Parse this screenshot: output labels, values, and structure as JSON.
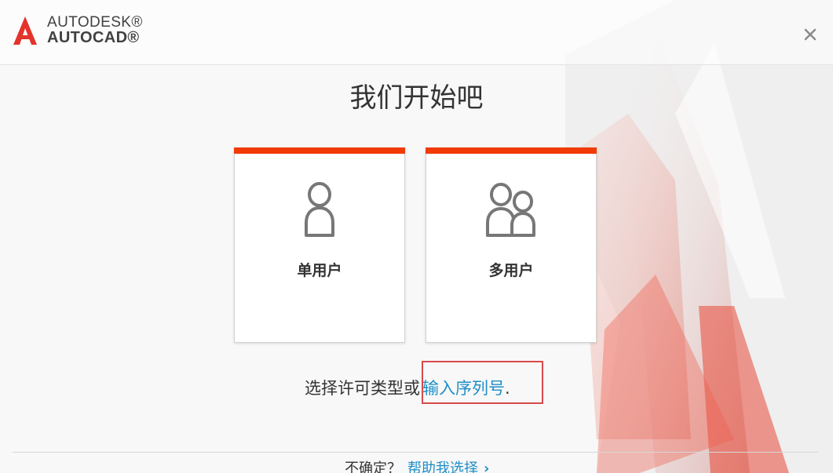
{
  "brand": {
    "line1": "AUTODESK®",
    "line2": "AUTOCAD®",
    "accent": "#f13a06",
    "logo_icon": "autodesk-a-icon"
  },
  "window": {
    "close_icon": "close-icon",
    "title": "我们开始吧"
  },
  "cards": [
    {
      "label": "单用户",
      "icon": "single-user-icon"
    },
    {
      "label": "多用户",
      "icon": "multi-user-icon"
    }
  ],
  "license_prompt": {
    "text": "选择许可类型或",
    "link": "输入序列号",
    "suffix": "."
  },
  "footer": {
    "question": "不确定？",
    "help_link": "帮助我选择",
    "chevron_icon": "chevron-right-icon"
  },
  "colors": {
    "link": "#1f8ec8",
    "highlight_box": "#d84a4a",
    "card_top": "#f13a06"
  }
}
